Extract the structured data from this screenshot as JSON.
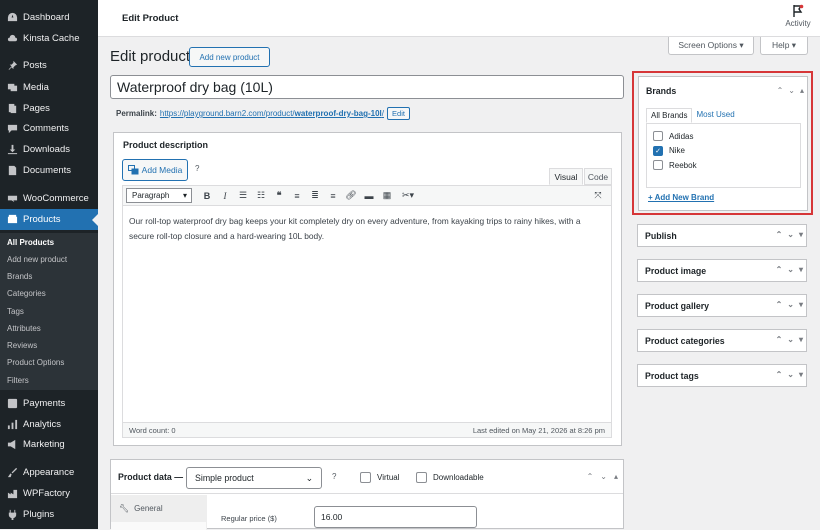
{
  "topbar": {
    "title": "Edit Product",
    "activity_label": "Activity"
  },
  "screen_options": {
    "screen_label": "Screen Options ▾",
    "help_label": "Help ▾"
  },
  "sidebar": {
    "items": [
      {
        "label": "Dashboard",
        "icon": "dashboard-icon"
      },
      {
        "label": "Kinsta Cache",
        "icon": "cloud-icon"
      },
      {
        "label": "Posts",
        "icon": "pin-icon"
      },
      {
        "label": "Media",
        "icon": "media-icon"
      },
      {
        "label": "Pages",
        "icon": "pages-icon"
      },
      {
        "label": "Comments",
        "icon": "comment-icon"
      },
      {
        "label": "Downloads",
        "icon": "download-icon"
      },
      {
        "label": "Documents",
        "icon": "document-icon"
      },
      {
        "label": "WooCommerce",
        "icon": "woo-icon"
      },
      {
        "label": "Products",
        "icon": "products-icon"
      },
      {
        "label": "Payments",
        "icon": "payments-icon"
      },
      {
        "label": "Analytics",
        "icon": "analytics-icon"
      },
      {
        "label": "Marketing",
        "icon": "megaphone-icon"
      },
      {
        "label": "Appearance",
        "icon": "brush-icon"
      },
      {
        "label": "WPFactory",
        "icon": "factory-icon"
      },
      {
        "label": "Plugins",
        "icon": "plugin-icon"
      }
    ],
    "submenu": [
      "All Products",
      "Add new product",
      "Brands",
      "Categories",
      "Tags",
      "Attributes",
      "Reviews",
      "Product Options",
      "Filters"
    ]
  },
  "main": {
    "heading": "Edit product",
    "add_new_label": "Add new product",
    "product_title": "Waterproof dry bag (10L)",
    "permalink_label": "Permalink:",
    "permalink_base": "https://playground.barn2.com/product/",
    "permalink_slug": "waterproof-dry-bag-10l",
    "permalink_trail": "/",
    "edit_label": "Edit"
  },
  "description": {
    "heading": "Product description",
    "add_media": "Add Media",
    "help": "?",
    "tab_visual": "Visual",
    "tab_code": "Code",
    "format": "Paragraph",
    "content": "Our roll-top waterproof dry bag keeps your kit completely dry on every adventure, from kayaking trips to rainy hikes, with a secure roll-top closure and a hard-wearing 10L body.",
    "word_count": "Word count: 0",
    "last_edited": "Last edited on May 21, 2026 at 8:26 pm"
  },
  "brands": {
    "heading": "Brands",
    "tab_all": "All Brands",
    "tab_used": "Most Used",
    "items": [
      {
        "label": "Adidas",
        "checked": false
      },
      {
        "label": "Nike",
        "checked": true
      },
      {
        "label": "Reebok",
        "checked": false
      }
    ],
    "add_new": "+ Add New Brand",
    "highlight_color": "#d63638"
  },
  "side_boxes": [
    "Publish",
    "Product image",
    "Product gallery",
    "Product categories",
    "Product tags"
  ],
  "product_data": {
    "label": "Product data —",
    "type": "Simple product",
    "help": "?",
    "virtual": "Virtual",
    "downloadable": "Downloadable",
    "tab_general": "General",
    "price_label": "Regular price ($)",
    "price_value": "16.00"
  },
  "colors": {
    "accent": "#2271b1",
    "menu_bg": "#1d2327",
    "active_bg": "#2271b1"
  }
}
